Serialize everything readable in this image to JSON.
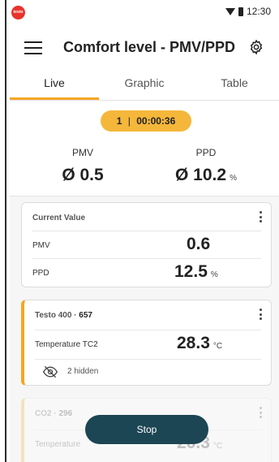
{
  "status_bar": {
    "time": "12:30",
    "logo_text": "testo",
    "icons": [
      "wifi-icon",
      "battery-icon"
    ]
  },
  "app_bar": {
    "title": "Comfort level - PMV/PPD",
    "icons": [
      "menu-icon",
      "gear-icon"
    ]
  },
  "tabs": [
    {
      "label": "Live",
      "active": true
    },
    {
      "label": "Graphic",
      "active": false
    },
    {
      "label": "Table",
      "active": false
    }
  ],
  "summary": {
    "timer_index": "1",
    "timer_separator": "|",
    "timer_time": "00:00:36",
    "pmv_label": "PMV",
    "pmv_value": "Ø 0.5",
    "ppd_label": "PPD",
    "ppd_value": "Ø 10.2",
    "ppd_unit": "%"
  },
  "cards": [
    {
      "title": "Current Value",
      "rows": [
        {
          "label": "PMV",
          "value": "0.6",
          "unit": ""
        },
        {
          "label": "PPD",
          "value": "12.5",
          "unit": "%"
        }
      ]
    },
    {
      "title_name": "Testo 400",
      "title_sep": " · ",
      "title_id": "657",
      "rows": [
        {
          "label": "Temperature TC2",
          "value": "28.3",
          "unit": "°C"
        }
      ],
      "hidden_label": "2 hidden"
    },
    {
      "title_name": "CO2",
      "title_sep": " · ",
      "title_id": "296",
      "rows": [
        {
          "label": "Temperature",
          "value": "26.3",
          "unit": "°C"
        }
      ]
    }
  ],
  "stop_button": {
    "label": "Stop"
  },
  "colors": {
    "accent": "#f5a623",
    "timer_bg": "#f5b73a",
    "stop_bg": "#1c4654",
    "logo": "#e8332a"
  }
}
